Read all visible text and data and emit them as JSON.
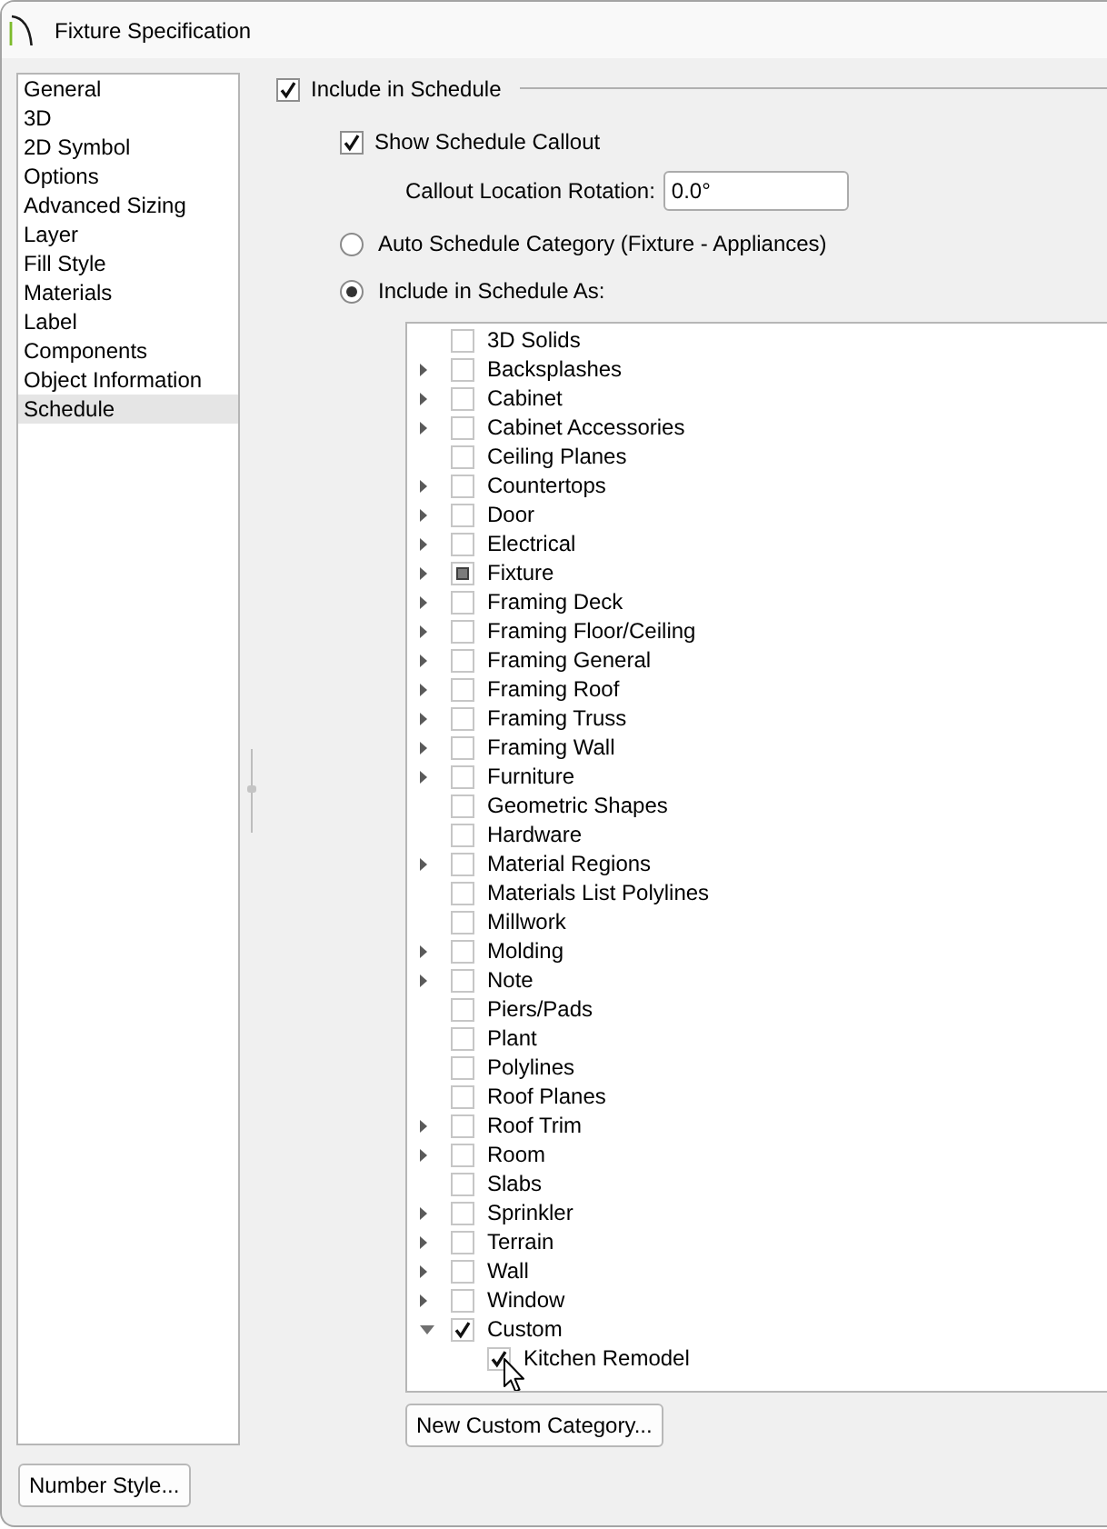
{
  "window": {
    "title": "Fixture Specification"
  },
  "sidebar": {
    "items": [
      {
        "label": "General",
        "selected": false
      },
      {
        "label": "3D",
        "selected": false
      },
      {
        "label": "2D Symbol",
        "selected": false
      },
      {
        "label": "Options",
        "selected": false
      },
      {
        "label": "Advanced Sizing",
        "selected": false
      },
      {
        "label": "Layer",
        "selected": false
      },
      {
        "label": "Fill Style",
        "selected": false
      },
      {
        "label": "Materials",
        "selected": false
      },
      {
        "label": "Label",
        "selected": false
      },
      {
        "label": "Components",
        "selected": false
      },
      {
        "label": "Object Information",
        "selected": false
      },
      {
        "label": "Schedule",
        "selected": true
      }
    ]
  },
  "schedule": {
    "include_in_schedule": {
      "label": "Include in Schedule",
      "checked": true
    },
    "show_callout": {
      "label": "Show Schedule Callout",
      "checked": true
    },
    "callout_rotation": {
      "label": "Callout Location Rotation:",
      "value": "0.0°"
    },
    "options": [
      {
        "label": "Auto Schedule Category (Fixture - Appliances)",
        "selected": false
      },
      {
        "label": "Include in Schedule As:",
        "selected": true
      }
    ],
    "categories": [
      {
        "label": "3D Solids",
        "checked": false,
        "indeterminate": false
      },
      {
        "label": "Backsplashes",
        "expanded": false,
        "checked": false,
        "indeterminate": false
      },
      {
        "label": "Cabinet",
        "expanded": false,
        "checked": false,
        "indeterminate": false
      },
      {
        "label": "Cabinet Accessories",
        "expanded": false,
        "checked": false,
        "indeterminate": false
      },
      {
        "label": "Ceiling Planes",
        "checked": false,
        "indeterminate": false
      },
      {
        "label": "Countertops",
        "expanded": false,
        "checked": false,
        "indeterminate": false
      },
      {
        "label": "Door",
        "expanded": false,
        "checked": false,
        "indeterminate": false
      },
      {
        "label": "Electrical",
        "expanded": false,
        "checked": false,
        "indeterminate": false
      },
      {
        "label": "Fixture",
        "expanded": false,
        "checked": false,
        "indeterminate": true
      },
      {
        "label": "Framing Deck",
        "expanded": false,
        "checked": false,
        "indeterminate": false
      },
      {
        "label": "Framing Floor/Ceiling",
        "expanded": false,
        "checked": false,
        "indeterminate": false
      },
      {
        "label": "Framing General",
        "expanded": false,
        "checked": false,
        "indeterminate": false
      },
      {
        "label": "Framing Roof",
        "expanded": false,
        "checked": false,
        "indeterminate": false
      },
      {
        "label": "Framing Truss",
        "expanded": false,
        "checked": false,
        "indeterminate": false
      },
      {
        "label": "Framing Wall",
        "expanded": false,
        "checked": false,
        "indeterminate": false
      },
      {
        "label": "Furniture",
        "expanded": false,
        "checked": false,
        "indeterminate": false
      },
      {
        "label": "Geometric Shapes",
        "checked": false,
        "indeterminate": false
      },
      {
        "label": "Hardware",
        "checked": false,
        "indeterminate": false
      },
      {
        "label": "Material Regions",
        "expanded": false,
        "checked": false,
        "indeterminate": false
      },
      {
        "label": "Materials List Polylines",
        "checked": false,
        "indeterminate": false
      },
      {
        "label": "Millwork",
        "checked": false,
        "indeterminate": false
      },
      {
        "label": "Molding",
        "expanded": false,
        "checked": false,
        "indeterminate": false
      },
      {
        "label": "Note",
        "expanded": false,
        "checked": false,
        "indeterminate": false
      },
      {
        "label": "Piers/Pads",
        "checked": false,
        "indeterminate": false
      },
      {
        "label": "Plant",
        "checked": false,
        "indeterminate": false
      },
      {
        "label": "Polylines",
        "checked": false,
        "indeterminate": false
      },
      {
        "label": "Roof Planes",
        "checked": false,
        "indeterminate": false
      },
      {
        "label": "Roof Trim",
        "expanded": false,
        "checked": false,
        "indeterminate": false
      },
      {
        "label": "Room",
        "expanded": false,
        "checked": false,
        "indeterminate": false
      },
      {
        "label": "Slabs",
        "checked": false,
        "indeterminate": false
      },
      {
        "label": "Sprinkler",
        "expanded": false,
        "checked": false,
        "indeterminate": false
      },
      {
        "label": "Terrain",
        "expanded": false,
        "checked": false,
        "indeterminate": false
      },
      {
        "label": "Wall",
        "expanded": false,
        "checked": false,
        "indeterminate": false
      },
      {
        "label": "Window",
        "expanded": false,
        "checked": false,
        "indeterminate": false
      },
      {
        "label": "Custom",
        "expanded": true,
        "checked": true,
        "indeterminate": false,
        "children": [
          {
            "label": "Kitchen Remodel",
            "checked": true,
            "indeterminate": false
          }
        ]
      }
    ],
    "new_category_button": "New Custom Category..."
  },
  "number_style_button": "Number Style..."
}
